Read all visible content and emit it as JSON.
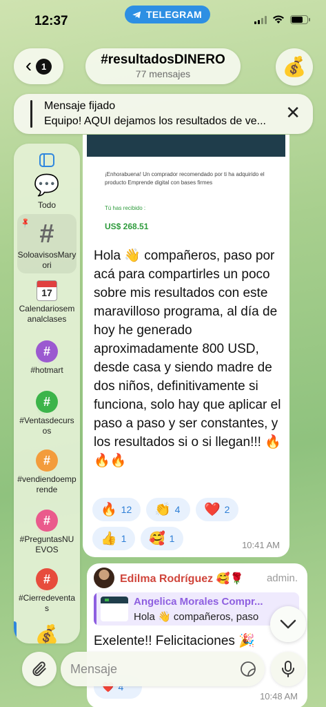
{
  "status_bar": {
    "time": "12:37",
    "app_pill": "TELEGRAM"
  },
  "header": {
    "back_badge": "1",
    "title": "#resultadosDINERO",
    "subtitle": "77 mensajes",
    "avatar_icon": "moneybag-emoji"
  },
  "pinned": {
    "label": "Mensaje fijado",
    "text": "Equipo! AQUI dejamos los resultados de ve..."
  },
  "topics": [
    {
      "label": "Todo",
      "icon": "chat-bubbles-icon"
    },
    {
      "label": "SoloavisosMaryori",
      "icon": "hash-grey-icon"
    },
    {
      "label": "Calendariosemanalclases",
      "icon": "calendar-icon",
      "day": "17"
    },
    {
      "label": "#hotmart",
      "icon": "hash-bubble-icon",
      "color": "#9b59d0"
    },
    {
      "label": "#Ventasdecursos",
      "icon": "hash-bubble-icon",
      "color": "#3cb44a"
    },
    {
      "label": "#vendiendoemprende",
      "icon": "hash-bubble-icon",
      "color": "#f39c3c"
    },
    {
      "label": "#PreguntasNUEVOS",
      "icon": "hash-bubble-icon",
      "color": "#ea5a8c"
    },
    {
      "label": "#Cierredeventas",
      "icon": "hash-bubble-icon",
      "color": "#e74c3c"
    }
  ],
  "message1": {
    "screenshot": {
      "text": "¡Enhorabuena! Un comprador recomendado por ti ha adquirido el producto Emprende digital con bases firmes",
      "received_label": "Tú has recibido :",
      "amount": "US$ 268.51"
    },
    "text": "Hola 👋 compañeros, paso por acá para compartirles un poco sobre mis resultados con este maravilloso programa, al día de hoy he generado aproximadamente 800 USD, desde casa y siendo madre de dos niños, definitivamente si funciona, solo hay que aplicar el paso a paso y ser constantes, y los resultados si o si llegan!!! 🔥🔥🔥",
    "reactions": [
      {
        "emoji": "🔥",
        "count": "12"
      },
      {
        "emoji": "👏",
        "count": "4"
      },
      {
        "emoji": "❤️",
        "count": "2"
      },
      {
        "emoji": "👍",
        "count": "1"
      },
      {
        "emoji": "🥰",
        "count": "1"
      }
    ],
    "time": "10:41 AM"
  },
  "message2": {
    "author": "Edilma Rodríguez 🥰🌹",
    "role": "admin.",
    "reply_author": "Angelica Morales Compr...",
    "reply_text": "Hola 👋 compañeros, paso",
    "text": "Exelente!! Felicitaciones 🎉",
    "reaction": {
      "emoji": "❤️",
      "count": "4"
    },
    "time": "10:48 AM"
  },
  "input": {
    "placeholder": "Mensaje"
  },
  "colors": {
    "accent": "#2e86de",
    "telegram_blue": "#2d8fe3",
    "author_red": "#d0453b",
    "reply_purple": "#8e5fe0"
  }
}
